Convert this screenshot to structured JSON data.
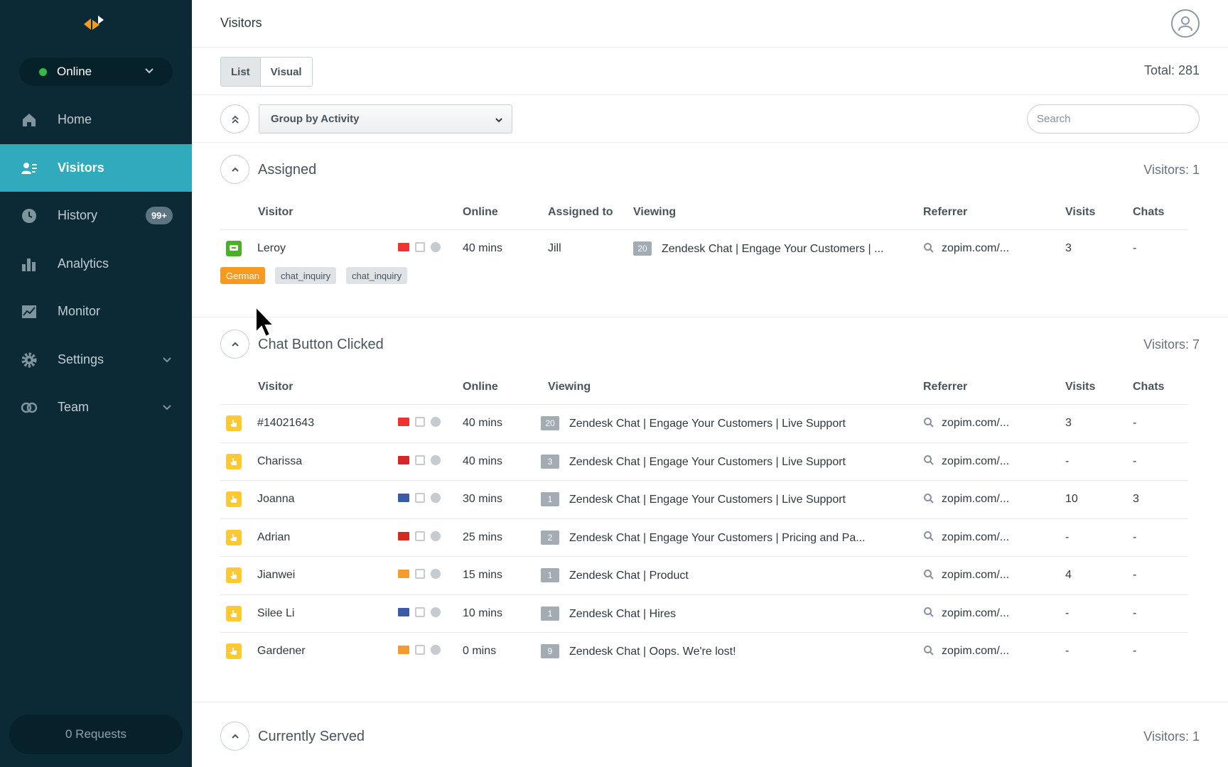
{
  "sidebar": {
    "status": "Online",
    "nav": [
      {
        "label": "Home",
        "icon": "home-icon"
      },
      {
        "label": "Visitors",
        "icon": "visitors-icon",
        "active": true
      },
      {
        "label": "History",
        "icon": "clock-icon",
        "badge": "99+"
      },
      {
        "label": "Analytics",
        "icon": "bar-chart-icon"
      },
      {
        "label": "Monitor",
        "icon": "monitor-chart-icon"
      },
      {
        "label": "Settings",
        "icon": "gear-icon",
        "expandable": true
      },
      {
        "label": "Team",
        "icon": "team-icon",
        "expandable": true
      }
    ],
    "requests": "0 Requests"
  },
  "header": {
    "title": "Visitors"
  },
  "view": {
    "list_label": "List",
    "visual_label": "Visual",
    "total": "Total: 281"
  },
  "filter": {
    "group_by": "Group by Activity",
    "search_placeholder": "Search"
  },
  "sections": {
    "assigned": {
      "title": "Assigned",
      "count": "Visitors: 1",
      "columns": [
        "Visitor",
        "Online",
        "Assigned to",
        "Viewing",
        "Referrer",
        "Visits",
        "Chats"
      ],
      "rows": [
        {
          "visitor": "Leroy",
          "online": "40 mins",
          "assigned_to": "Jill",
          "pages": "20",
          "viewing": "Zendesk Chat | Engage Your Customers | ...",
          "referrer": "zopim.com/...",
          "visits": "3",
          "chats": "-"
        }
      ],
      "tags": [
        "German",
        "chat_inquiry",
        "chat_inquiry"
      ]
    },
    "chat_clicked": {
      "title": "Chat Button Clicked",
      "count": "Visitors: 7",
      "columns": [
        "Visitor",
        "Online",
        "Viewing",
        "Referrer",
        "Visits",
        "Chats"
      ],
      "rows": [
        {
          "visitor": "#14021643",
          "online": "40 mins",
          "pages": "20",
          "viewing": "Zendesk Chat | Engage Your Customers | Live Support",
          "referrer": "zopim.com/...",
          "visits": "3",
          "chats": "-",
          "flag": "#e33"
        },
        {
          "visitor": "Charissa",
          "online": "40 mins",
          "pages": "3",
          "viewing": "Zendesk Chat | Engage Your Customers | Live Support",
          "referrer": "zopim.com/...",
          "visits": "-",
          "chats": "-",
          "flag": "#d8262b"
        },
        {
          "visitor": "Joanna",
          "online": "30 mins",
          "pages": "1",
          "viewing": "Zendesk Chat | Engage Your Customers | Live Support",
          "referrer": "zopim.com/...",
          "visits": "10",
          "chats": "3",
          "flag": "#3c5aa6"
        },
        {
          "visitor": "Adrian",
          "online": "25 mins",
          "pages": "2",
          "viewing": "Zendesk Chat | Engage Your Customers | Pricing and Pa...",
          "referrer": "zopim.com/...",
          "visits": "-",
          "chats": "-",
          "flag": "#d52b1e"
        },
        {
          "visitor": "Jianwei",
          "online": "15 mins",
          "pages": "1",
          "viewing": "Zendesk Chat | Product",
          "referrer": "zopim.com/...",
          "visits": "4",
          "chats": "-",
          "flag": "#f59a2c"
        },
        {
          "visitor": "Silee Li",
          "online": "10 mins",
          "pages": "1",
          "viewing": "Zendesk Chat | Hires",
          "referrer": "zopim.com/...",
          "visits": "-",
          "chats": "-",
          "flag": "#3c5aa6"
        },
        {
          "visitor": "Gardener",
          "online": "0 mins",
          "pages": "9",
          "viewing": "Zendesk Chat | Oops. We're lost!",
          "referrer": "zopim.com/...",
          "visits": "-",
          "chats": "-",
          "flag": "#f59a2c"
        }
      ]
    },
    "served": {
      "title": "Currently Served",
      "count": "Visitors: 1"
    }
  },
  "colors": {
    "sidebar_bg": "#0b2a36",
    "active_nav": "#30aabc",
    "online": "#34b84a",
    "tag_language": "#f79a1e",
    "status_clicked": "#ffc933",
    "status_assigned": "#4caf2a"
  }
}
